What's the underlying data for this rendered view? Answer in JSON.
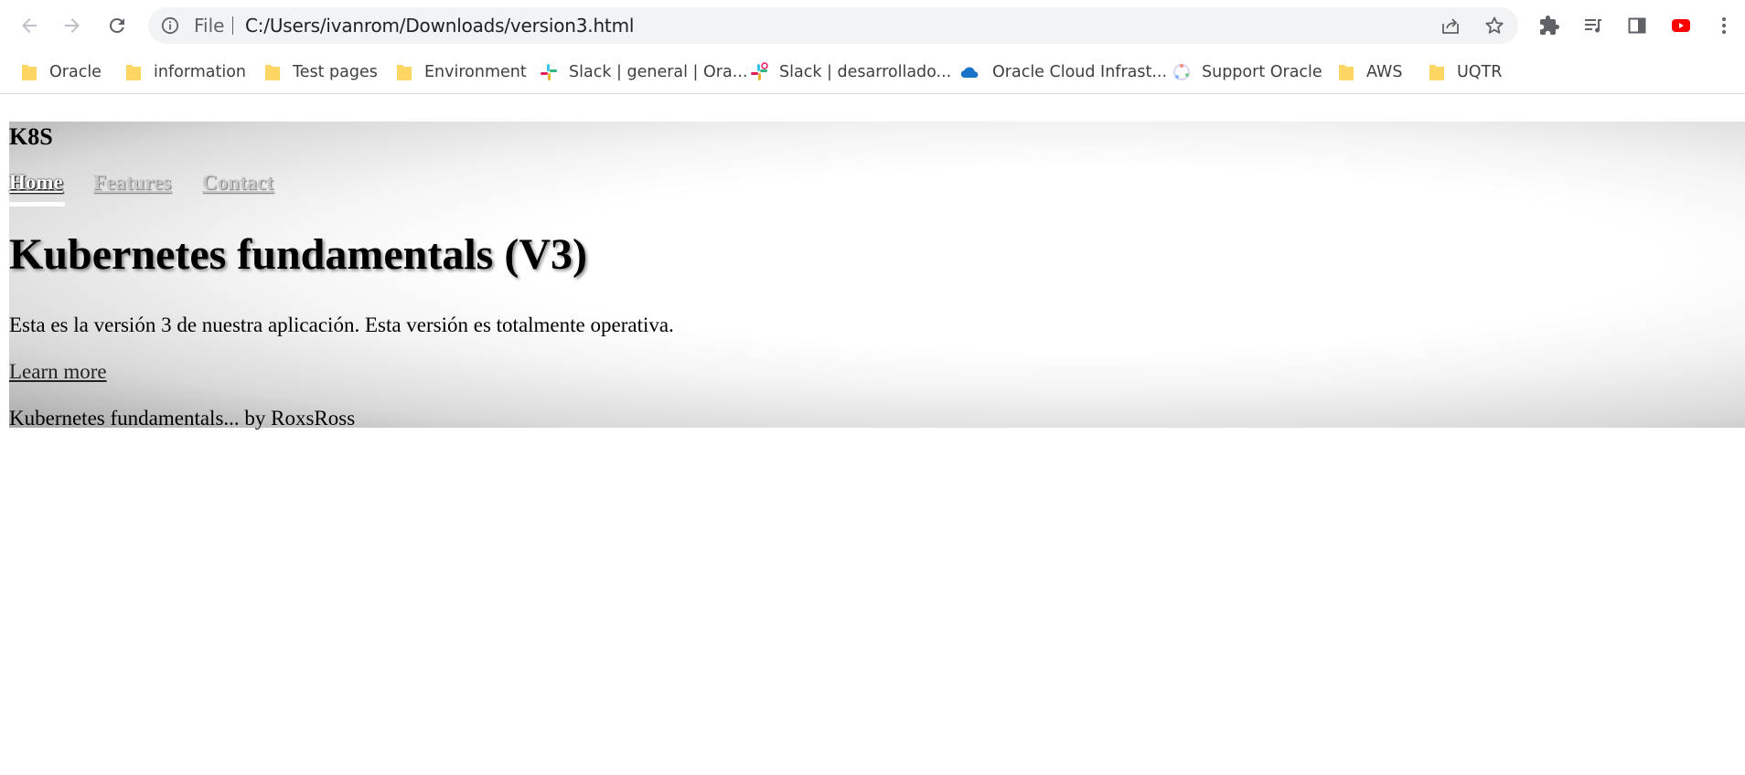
{
  "browser": {
    "url_scheme": "File",
    "url": "C:/Users/ivanrom/Downloads/version3.html",
    "toolbar_icons": [
      "back-arrow-icon",
      "forward-arrow-icon",
      "reload-icon",
      "info-icon",
      "share-icon",
      "star-icon",
      "extensions-puzzle-icon",
      "reading-list-icon",
      "side-panel-icon",
      "youtube-icon",
      "kebab-menu-icon"
    ]
  },
  "bookmarks": [
    {
      "label": "Oracle",
      "icon": "folder-icon"
    },
    {
      "label": "information",
      "icon": "folder-icon"
    },
    {
      "label": "Test pages",
      "icon": "folder-icon"
    },
    {
      "label": "Environment",
      "icon": "folder-icon"
    },
    {
      "label": "Slack | general | Ora...",
      "icon": "slack-icon"
    },
    {
      "label": "Slack | desarrollado...",
      "icon": "slack-icon"
    },
    {
      "label": "Oracle Cloud Infrast...",
      "icon": "cloud-icon"
    },
    {
      "label": "Support Oracle",
      "icon": "support-oracle-icon"
    },
    {
      "label": "AWS",
      "icon": "folder-icon"
    },
    {
      "label": "UQTR",
      "icon": "folder-icon"
    }
  ],
  "page": {
    "brand": "K8S",
    "nav": {
      "home": "Home",
      "features": "Features",
      "contact": "Contact"
    },
    "headline": "Kubernetes fundamentals (V3)",
    "lede": "Esta es la versión 3 de nuestra aplicación. Esta versión es totalmente operativa.",
    "cta": "Learn more",
    "footer": "Kubernetes fundamentals... by RoxsRoss"
  },
  "colors": {
    "folder": "#fdd663",
    "youtube": "#ff0000",
    "oracle_cloud": "#1a73c8",
    "nav_active": "#ffffff",
    "nav_inactive": "#c8c8c8"
  }
}
